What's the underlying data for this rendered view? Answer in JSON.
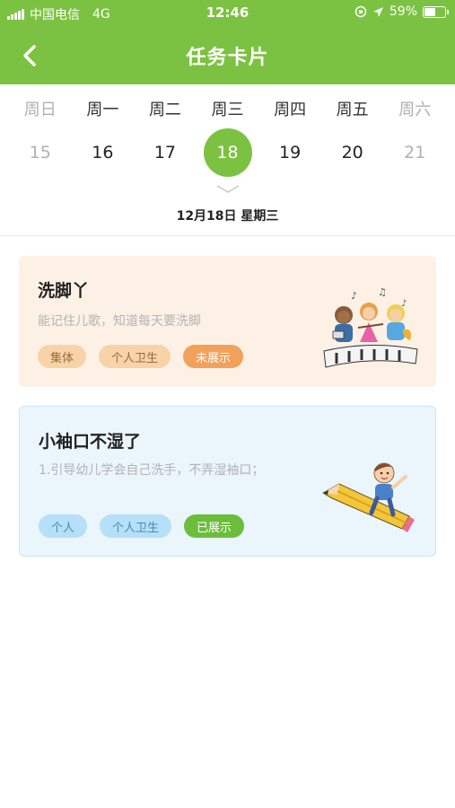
{
  "status_bar": {
    "carrier": "中国电信",
    "network": "4G",
    "time": "12:46",
    "battery": "59%",
    "battery_level": 0.59
  },
  "nav": {
    "title": "任务卡片",
    "back_icon": "chevron-left-icon"
  },
  "calendar": {
    "weekdays": [
      "周日",
      "周一",
      "周二",
      "周三",
      "周四",
      "周五",
      "周六"
    ],
    "dates": [
      "15",
      "16",
      "17",
      "18",
      "19",
      "20",
      "21"
    ],
    "selected_index": 3,
    "date_label": "12月18日 星期三",
    "expand_icon": "chevron-down-icon"
  },
  "cards": [
    {
      "title": "洗脚丫",
      "description": "能记住儿歌，知道每天要洗脚",
      "tags": [
        "集体",
        "个人卫生",
        "未展示"
      ],
      "illustration_icon": "kids-band-illustration"
    },
    {
      "title": "小袖口不湿了",
      "description": "1.引导幼儿学会自己洗手，不弄湿袖口；",
      "tags": [
        "个人",
        "个人卫生",
        "已展示"
      ],
      "illustration_icon": "boy-on-pencil-illustration"
    }
  ],
  "colors": {
    "primary": "#7cc242",
    "card1_bg": "#fdf1e6",
    "card2_bg": "#eaf5fc",
    "tag_orange": "#f2a15a",
    "tag_green": "#6cbd3c"
  }
}
